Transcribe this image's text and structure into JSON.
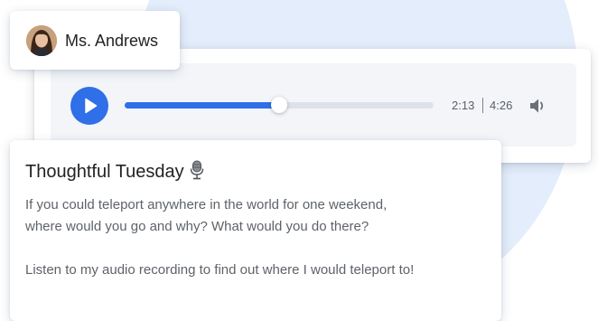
{
  "teacher": {
    "name": "Ms. Andrews",
    "avatar_icon": "teacher-avatar"
  },
  "player": {
    "current_time": "2:13",
    "total_time": "4:26",
    "progress": 0.5,
    "play_icon": "play-icon",
    "volume_icon": "volume-icon",
    "accent_color": "#2f6fe8"
  },
  "post": {
    "title": "Thoughtful Tuesday",
    "title_icon": "microphone-icon",
    "prompt_line1": "If you could teleport anywhere in the world for one weekend,",
    "prompt_line2": "where would you go and why? What would you do there?",
    "instruction": "Listen to my audio recording to find out where I would teleport to!"
  }
}
